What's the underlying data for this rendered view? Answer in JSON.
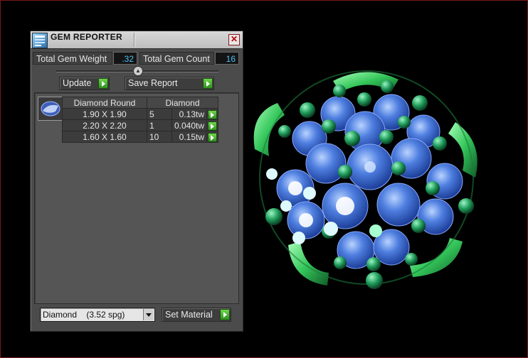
{
  "window": {
    "title": "GEM REPORTER",
    "close_glyph": "✕"
  },
  "stats": {
    "weight_label": "Total Gem Weight",
    "weight_value": ".32",
    "count_label": "Total Gem Count",
    "count_value": "16"
  },
  "buttons": {
    "update": "Update",
    "save_report": "Save Report",
    "set_material": "Set Material"
  },
  "table": {
    "headers": [
      "Diamond Round",
      "Diamond"
    ],
    "rows": [
      {
        "size": "1.90 X 1.90",
        "count": "5",
        "weight": "0.13tw"
      },
      {
        "size": "2.20 X 2.20",
        "count": "1",
        "weight": "0.040tw"
      },
      {
        "size": "1.60 X 1.60",
        "count": "10",
        "weight": "0.15tw"
      }
    ]
  },
  "material": {
    "selected": "Diamond    (3.52 spg)"
  },
  "icons": [
    "app-gem-icon",
    "close-icon",
    "collapse-arrow-icon",
    "play-arrow-icon",
    "gem-thumbnail-icon",
    "chevron-down-icon"
  ],
  "colors": {
    "panel": "#4b4b4b",
    "value_text": "#4fc3f7",
    "accent_green": "#3fb52a",
    "gem_blue": "#3f6fd6",
    "metal_green": "#2fbf5a"
  }
}
